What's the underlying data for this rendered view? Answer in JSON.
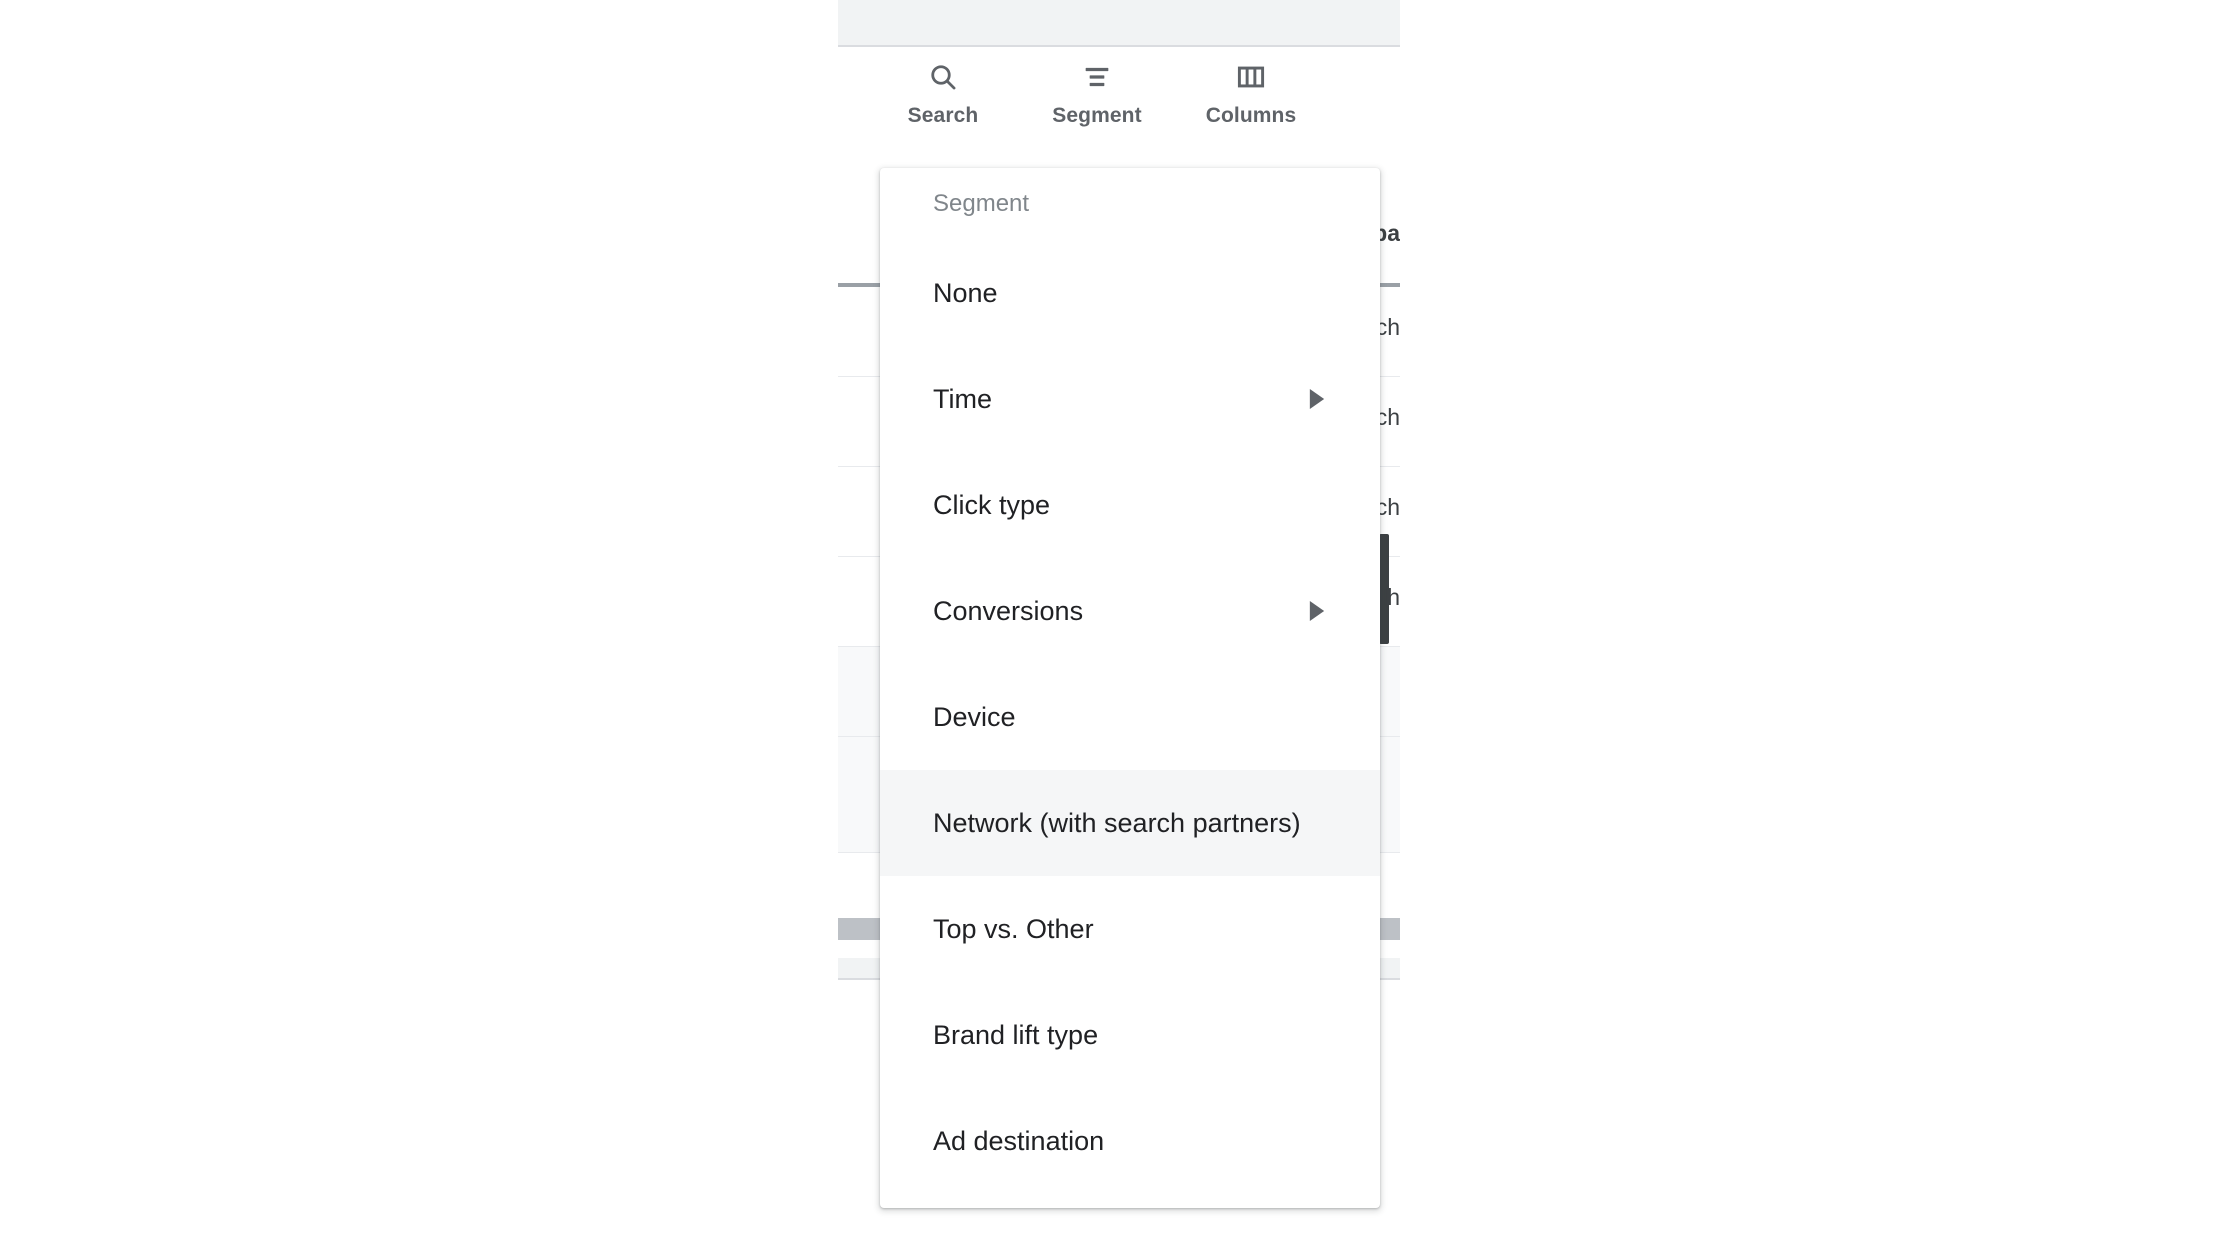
{
  "toolbar": {
    "buttons": [
      {
        "label": "Search",
        "icon": "search-icon"
      },
      {
        "label": "Segment",
        "icon": "segment-icon"
      },
      {
        "label": "Columns",
        "icon": "columns-icon"
      }
    ]
  },
  "segment_menu": {
    "header": "Segment",
    "highlighted_item": "Network (with search partners)",
    "items": [
      {
        "label": "None",
        "has_submenu": false
      },
      {
        "label": "Time",
        "has_submenu": true
      },
      {
        "label": "Click type",
        "has_submenu": false
      },
      {
        "label": "Conversions",
        "has_submenu": true
      },
      {
        "label": "Device",
        "has_submenu": false
      },
      {
        "label": "Network (with search partners)",
        "has_submenu": false
      },
      {
        "label": "Top vs. Other",
        "has_submenu": false
      },
      {
        "label": "Brand lift type",
        "has_submenu": false
      },
      {
        "label": "Ad destination",
        "has_submenu": false
      }
    ]
  },
  "table": {
    "header_fragment": "pa",
    "cell_fragments": [
      "ch",
      "ch",
      "ch",
      "ch"
    ]
  },
  "colors": {
    "page_background": "#f1f3f4",
    "card_background": "#ffffff",
    "icon": "#5f6368",
    "menu_text": "#202124",
    "menu_header_text": "#80868b",
    "menu_highlight": "#f5f6f7",
    "scrollbar_thumb": "#bdc1c6",
    "row_divider": "#e8eaed",
    "header_rule": "#9aa0a6"
  }
}
